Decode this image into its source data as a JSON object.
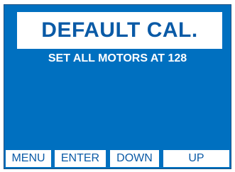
{
  "screen": {
    "title": "DEFAULT CAL.",
    "subtitle": "SET ALL MOTORS AT 128"
  },
  "softkeys": {
    "menu": "MENU",
    "enter": "ENTER",
    "down": "DOWN",
    "up": "UP"
  },
  "colors": {
    "screen_background": "#0070c0",
    "title_text": "#0a5aa6",
    "softkey_background": "#ffffff",
    "subtitle_text": "#ffffff"
  }
}
